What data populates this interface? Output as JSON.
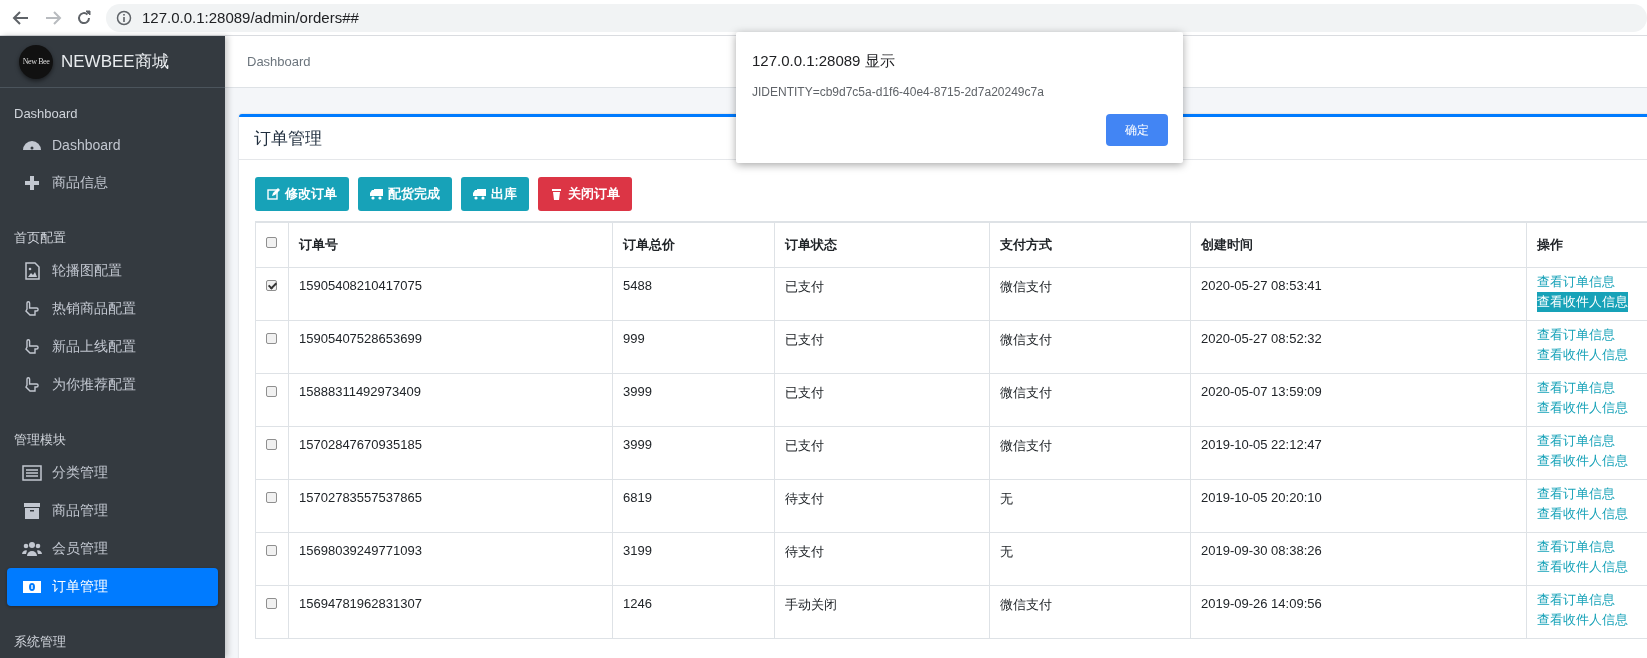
{
  "browser": {
    "url": "127.0.0.1:28089/admin/orders##"
  },
  "sidebar": {
    "brand": "NEWBEE商城",
    "logo_text": "New Bee",
    "sections": [
      {
        "title": "Dashboard",
        "items": [
          {
            "label": "Dashboard",
            "kind": "dashboard",
            "selected": false
          },
          {
            "label": "商品信息",
            "kind": "plus",
            "selected": false
          }
        ]
      },
      {
        "title": "首页配置",
        "items": [
          {
            "label": "轮播图配置",
            "kind": "image",
            "selected": false
          },
          {
            "label": "热销商品配置",
            "kind": "hand",
            "selected": false
          },
          {
            "label": "新品上线配置",
            "kind": "hand",
            "selected": false
          },
          {
            "label": "为你推荐配置",
            "kind": "hand",
            "selected": false
          }
        ]
      },
      {
        "title": "管理模块",
        "items": [
          {
            "label": "分类管理",
            "kind": "list",
            "selected": false
          },
          {
            "label": "商品管理",
            "kind": "archive",
            "selected": false
          },
          {
            "label": "会员管理",
            "kind": "users",
            "selected": false
          },
          {
            "label": "订单管理",
            "kind": "money",
            "selected": true
          }
        ]
      },
      {
        "title": "系统管理"
      }
    ]
  },
  "breadcrumb": "Dashboard",
  "card": {
    "title": "订单管理",
    "buttons": [
      {
        "label": "修改订单",
        "kind": "edit"
      },
      {
        "label": "配货完成",
        "kind": "truck"
      },
      {
        "label": "出库",
        "kind": "truck"
      },
      {
        "label": "关闭订单",
        "kind": "trash"
      }
    ],
    "table": {
      "select_all_checked": false,
      "columns": [
        "订单号",
        "订单总价",
        "订单状态",
        "支付方式",
        "创建时间",
        "操作"
      ],
      "rows": [
        {
          "checked": true,
          "cells": [
            "15905408210417075",
            "5488",
            "已支付",
            "微信支付",
            "2020-05-27 08:53:41"
          ],
          "actions": [
            {
              "label": "查看订单信息",
              "highlighted": false
            },
            {
              "label": "查看收件人信息",
              "highlighted": true
            }
          ]
        },
        {
          "checked": false,
          "cells": [
            "15905407528653699",
            "999",
            "已支付",
            "微信支付",
            "2020-05-27 08:52:32"
          ],
          "actions": [
            {
              "label": "查看订单信息",
              "highlighted": false
            },
            {
              "label": "查看收件人信息",
              "highlighted": false
            }
          ]
        },
        {
          "checked": false,
          "cells": [
            "15888311492973409",
            "3999",
            "已支付",
            "微信支付",
            "2020-05-07 13:59:09"
          ],
          "actions": [
            {
              "label": "查看订单信息",
              "highlighted": false
            },
            {
              "label": "查看收件人信息",
              "highlighted": false
            }
          ]
        },
        {
          "checked": false,
          "cells": [
            "15702847670935185",
            "3999",
            "已支付",
            "微信支付",
            "2019-10-05 22:12:47"
          ],
          "actions": [
            {
              "label": "查看订单信息",
              "highlighted": false
            },
            {
              "label": "查看收件人信息",
              "highlighted": false
            }
          ]
        },
        {
          "checked": false,
          "cells": [
            "15702783557537865",
            "6819",
            "待支付",
            "无",
            "2019-10-05 20:20:10"
          ],
          "actions": [
            {
              "label": "查看订单信息",
              "highlighted": false
            },
            {
              "label": "查看收件人信息",
              "highlighted": false
            }
          ]
        },
        {
          "checked": false,
          "cells": [
            "15698039249771093",
            "3199",
            "待支付",
            "无",
            "2019-09-30 08:38:26"
          ],
          "actions": [
            {
              "label": "查看订单信息",
              "highlighted": false
            },
            {
              "label": "查看收件人信息",
              "highlighted": false
            }
          ]
        },
        {
          "checked": false,
          "cells": [
            "15694781962831307",
            "1246",
            "手动关闭",
            "微信支付",
            "2019-09-26 14:09:56"
          ],
          "actions": [
            {
              "label": "查看订单信息",
              "highlighted": false
            },
            {
              "label": "查看收件人信息",
              "highlighted": false
            }
          ]
        }
      ]
    }
  },
  "dialog": {
    "title": "127.0.0.1:28089 显示",
    "message": "JIDENTITY=cb9d7c5a-d1f6-40e4-8715-2d7a20249c7a",
    "ok": "确定"
  }
}
